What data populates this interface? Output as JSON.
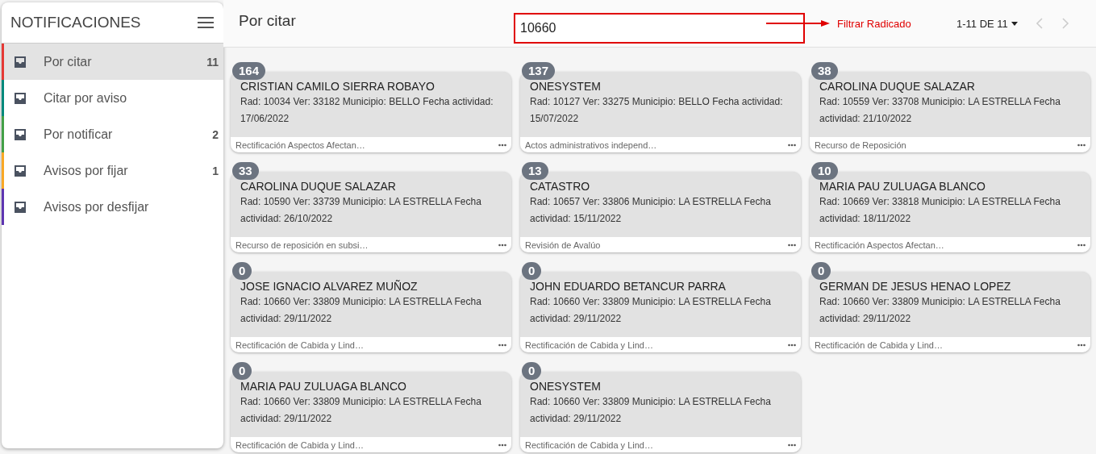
{
  "sidebar": {
    "title": "NOTIFICACIONES",
    "items": [
      {
        "label": "Por citar",
        "count": "11",
        "selected": true,
        "color": "#e53935"
      },
      {
        "label": "Citar por aviso",
        "selected": false,
        "color": "#00897b"
      },
      {
        "label": "Por notificar",
        "count": "2",
        "selected": false,
        "color": "#43a047"
      },
      {
        "label": "Avisos por fijar",
        "count": "1",
        "selected": false,
        "color": "#f9a825"
      },
      {
        "label": "Avisos por desfijar",
        "selected": false,
        "color": "#5e35b1"
      }
    ]
  },
  "header": {
    "title": "Por citar",
    "search": {
      "value": "10660"
    },
    "annotation": "Filtrar Radicado",
    "pagination": {
      "label": "1-11 DE 11",
      "prev_disabled": true,
      "next_disabled": true
    }
  },
  "cards": [
    {
      "badge": "164",
      "name": "CRISTIAN CAMILO SIERRA ROBAYO",
      "detail": "Rad: 10034 Ver: 33182 Municipio: BELLO Fecha actividad: 17/06/2022",
      "footer": "Rectificación Aspectos Afectan…"
    },
    {
      "badge": "137",
      "name": "ONESYSTEM",
      "detail": "Rad: 10127 Ver: 33275 Municipio: BELLO Fecha actividad: 15/07/2022",
      "footer": "Actos administrativos independ…"
    },
    {
      "badge": "38",
      "name": "CAROLINA DUQUE SALAZAR",
      "detail": "Rad: 10559 Ver: 33708 Municipio: LA ESTRELLA Fecha actividad: 21/10/2022",
      "footer": "Recurso de Reposición"
    },
    {
      "badge": "33",
      "name": "CAROLINA DUQUE SALAZAR",
      "detail": "Rad: 10590 Ver: 33739 Municipio: LA ESTRELLA Fecha actividad: 26/10/2022",
      "footer": "Recurso de reposición en subsi…"
    },
    {
      "badge": "13",
      "name": "CATASTRO",
      "detail": "Rad: 10657 Ver: 33806 Municipio: LA ESTRELLA Fecha actividad: 15/11/2022",
      "footer": "Revisión de Avalúo"
    },
    {
      "badge": "10",
      "name": "MARIA PAU ZULUAGA BLANCO",
      "detail": "Rad: 10669 Ver: 33818 Municipio: LA ESTRELLA Fecha actividad: 18/11/2022",
      "footer": "Rectificación Aspectos Afectan…"
    },
    {
      "badge": "0",
      "name": "JOSE IGNACIO ALVAREZ MUÑOZ",
      "detail": "Rad: 10660 Ver: 33809 Municipio: LA ESTRELLA Fecha actividad: 29/11/2022",
      "footer": "Rectificación de Cabida y Lind…"
    },
    {
      "badge": "0",
      "name": "JOHN EDUARDO BETANCUR PARRA",
      "detail": "Rad: 10660 Ver: 33809 Municipio: LA ESTRELLA Fecha actividad: 29/11/2022",
      "footer": "Rectificación de Cabida y Lind…"
    },
    {
      "badge": "0",
      "name": "GERMAN DE JESUS HENAO LOPEZ",
      "detail": "Rad: 10660 Ver: 33809 Municipio: LA ESTRELLA Fecha actividad: 29/11/2022",
      "footer": "Rectificación de Cabida y Lind…"
    },
    {
      "badge": "0",
      "name": "MARIA PAU ZULUAGA BLANCO",
      "detail": "Rad: 10660 Ver: 33809 Municipio: LA ESTRELLA Fecha actividad: 29/11/2022",
      "footer": "Rectificación de Cabida y Lind…"
    },
    {
      "badge": "0",
      "name": "ONESYSTEM",
      "detail": "Rad: 10660 Ver: 33809 Municipio: LA ESTRELLA Fecha actividad: 29/11/2022",
      "footer": "Rectificación de Cabida y Lind…"
    }
  ]
}
